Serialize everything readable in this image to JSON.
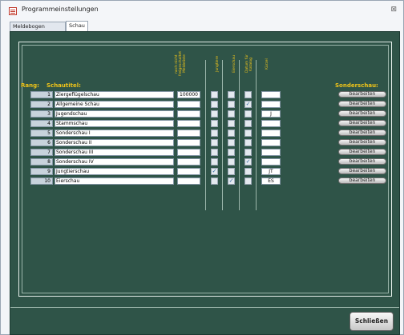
{
  "window": {
    "title": "Programmeinstellungen",
    "close_glyph": "⊠"
  },
  "tabs": [
    {
      "label": "Meldebogen (eMail)"
    },
    {
      "label": "Schau"
    }
  ],
  "headers": {
    "rang": "Rang:",
    "schautitel": "Schautitel:",
    "col_num": "noch nicht\nfreigeschaltet\nMeldeliste",
    "col_a": "Jungtiere",
    "col_b": "Eierschau",
    "col_c": "Datum für\nKatalog",
    "col_d": "Kürzel",
    "sonderschau": "Sonderschau:"
  },
  "rows": [
    {
      "num": "1",
      "name": "Ziergeflügelschau",
      "value": "100000",
      "a": false,
      "b": false,
      "c": false,
      "kurz": ""
    },
    {
      "num": "2",
      "name": "Allgemeine Schau",
      "value": "",
      "a": false,
      "b": false,
      "c": true,
      "kurz": ""
    },
    {
      "num": "3",
      "name": "Jugendschau",
      "value": "",
      "a": false,
      "b": false,
      "c": false,
      "kurz": "J"
    },
    {
      "num": "4",
      "name": "Stammschau",
      "value": "",
      "a": false,
      "b": false,
      "c": false,
      "kurz": ""
    },
    {
      "num": "5",
      "name": "Sonderschau I",
      "value": "",
      "a": false,
      "b": false,
      "c": false,
      "kurz": ""
    },
    {
      "num": "6",
      "name": "Sonderschau II",
      "value": "",
      "a": false,
      "b": false,
      "c": false,
      "kurz": ""
    },
    {
      "num": "7",
      "name": "Sonderschau III",
      "value": "",
      "a": false,
      "b": false,
      "c": false,
      "kurz": ""
    },
    {
      "num": "8",
      "name": "Sonderschau IV",
      "value": "",
      "a": false,
      "b": false,
      "c": true,
      "kurz": ""
    },
    {
      "num": "9",
      "name": "Jungtierschau",
      "value": "",
      "a": true,
      "b": false,
      "c": false,
      "kurz": "JT"
    },
    {
      "num": "10",
      "name": "Eierschau",
      "value": "",
      "a": false,
      "b": true,
      "c": false,
      "kurz": "ES"
    }
  ],
  "edit_label": "bearbeiten",
  "close_button": "Schließen",
  "check_glyph": "✓"
}
